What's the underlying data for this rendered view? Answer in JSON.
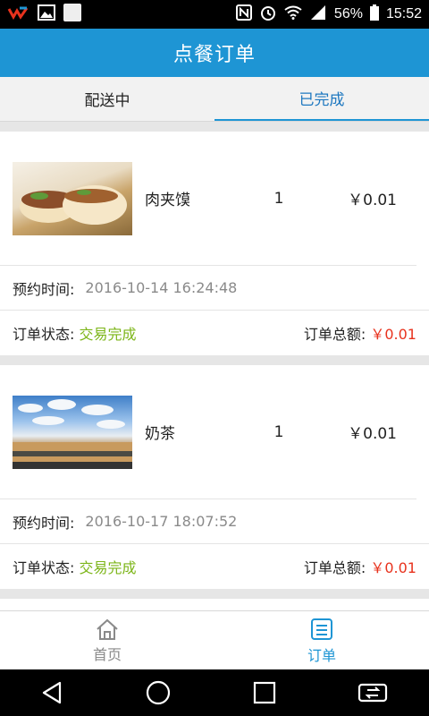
{
  "status_bar": {
    "battery": "56%",
    "time": "15:52",
    "network": "4G"
  },
  "header": {
    "title": "点餐订单"
  },
  "tabs": [
    {
      "label": "配送中",
      "active": false
    },
    {
      "label": "已完成",
      "active": true
    }
  ],
  "orders": [
    {
      "item_name": "肉夹馍",
      "qty": "1",
      "price": "￥0.01",
      "time_label": "预约时间:",
      "time_value": "2016-10-14 16:24:48",
      "status_label": "订单状态:",
      "status_value": "交易完成",
      "total_label": "订单总额:",
      "total_value": "￥0.01"
    },
    {
      "item_name": "奶茶",
      "qty": "1",
      "price": "￥0.01",
      "time_label": "预约时间:",
      "time_value": "2016-10-17 18:07:52",
      "status_label": "订单状态:",
      "status_value": "交易完成",
      "total_label": "订单总额:",
      "total_value": "￥0.01"
    }
  ],
  "bottom_nav": [
    {
      "label": "首页",
      "icon": "home-icon",
      "active": false
    },
    {
      "label": "订单",
      "icon": "order-icon",
      "active": true
    }
  ],
  "colors": {
    "brand": "#1e95d4",
    "status_green": "#7cb518",
    "price_red": "#e8321d"
  }
}
